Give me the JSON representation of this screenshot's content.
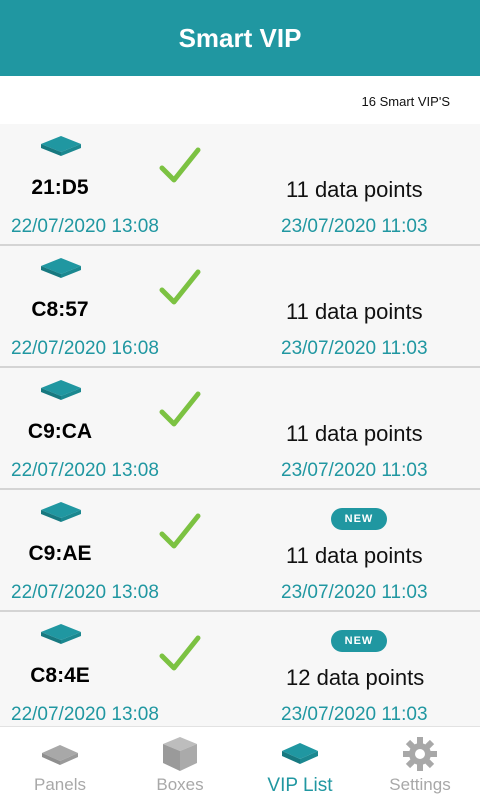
{
  "header": {
    "title": "Smart VIP"
  },
  "summary": {
    "count": "16 Smart VIP'S"
  },
  "colors": {
    "accent": "#2097a1",
    "check": "#7cc242",
    "inactive": "#a8a8a8"
  },
  "devices": [
    {
      "name": "21:D5",
      "date_left": "22/07/2020 13:08",
      "points": "11 data points",
      "date_right": "23/07/2020 11:03",
      "new": false
    },
    {
      "name": "C8:57",
      "date_left": "22/07/2020 16:08",
      "points": "11 data points",
      "date_right": "23/07/2020 11:03",
      "new": false
    },
    {
      "name": "C9:CA",
      "date_left": "22/07/2020 13:08",
      "points": "11 data points",
      "date_right": "23/07/2020 11:03",
      "new": false
    },
    {
      "name": "C9:AE",
      "date_left": "22/07/2020 13:08",
      "points": "11 data points",
      "date_right": "23/07/2020 11:03",
      "new": true
    },
    {
      "name": "C8:4E",
      "date_left": "22/07/2020 13:08",
      "points": "12 data points",
      "date_right": "23/07/2020 11:03",
      "new": true
    }
  ],
  "badge": {
    "new_label": "NEW"
  },
  "tabs": [
    {
      "label": "Panels",
      "icon": "panel-icon",
      "active": false
    },
    {
      "label": "Boxes",
      "icon": "box-icon",
      "active": false
    },
    {
      "label": "VIP List",
      "icon": "vip-device-icon",
      "active": true
    },
    {
      "label": "Settings",
      "icon": "gear-icon",
      "active": false
    }
  ]
}
